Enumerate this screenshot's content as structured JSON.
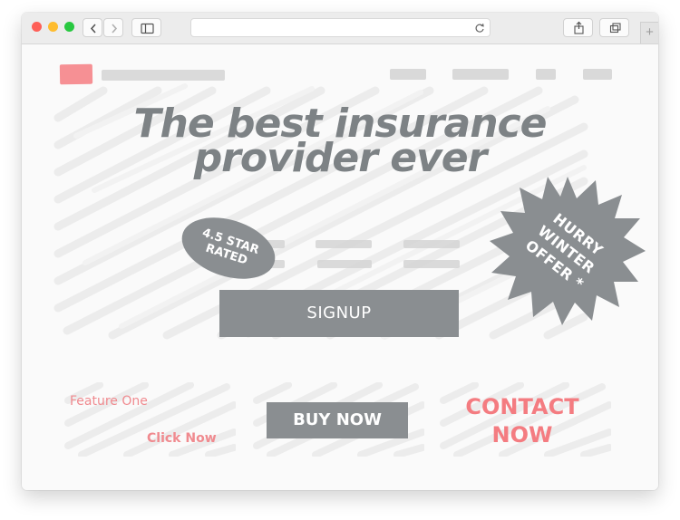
{
  "browser": {
    "traffic_lights": [
      "#fe5f57",
      "#febc2e",
      "#28c840"
    ],
    "icons": [
      "back-icon",
      "forward-icon",
      "sidebar-icon",
      "reload-icon",
      "share-icon",
      "tabs-icon",
      "new-tab-icon"
    ],
    "new_tab_label": "+"
  },
  "page": {
    "headline_line1": "The best insurance",
    "headline_line2": "provider ever",
    "rating_badge": [
      "4.5 STAR",
      "RATED"
    ],
    "offer_badge": [
      "HURRY",
      "WINTER",
      "OFFER *"
    ],
    "signup_label": "SIGNUP",
    "feature_label": "Feature One",
    "click_now_label": "Click Now",
    "buy_now_label": "BUY NOW",
    "contact_label_line1": "CONTACT",
    "contact_label_line2": "NOW"
  },
  "colors": {
    "accent": "#f47c81",
    "button_gray": "#8a8e91",
    "headline_gray": "#7d8285",
    "sketch_gray": "#d6d6d6"
  }
}
